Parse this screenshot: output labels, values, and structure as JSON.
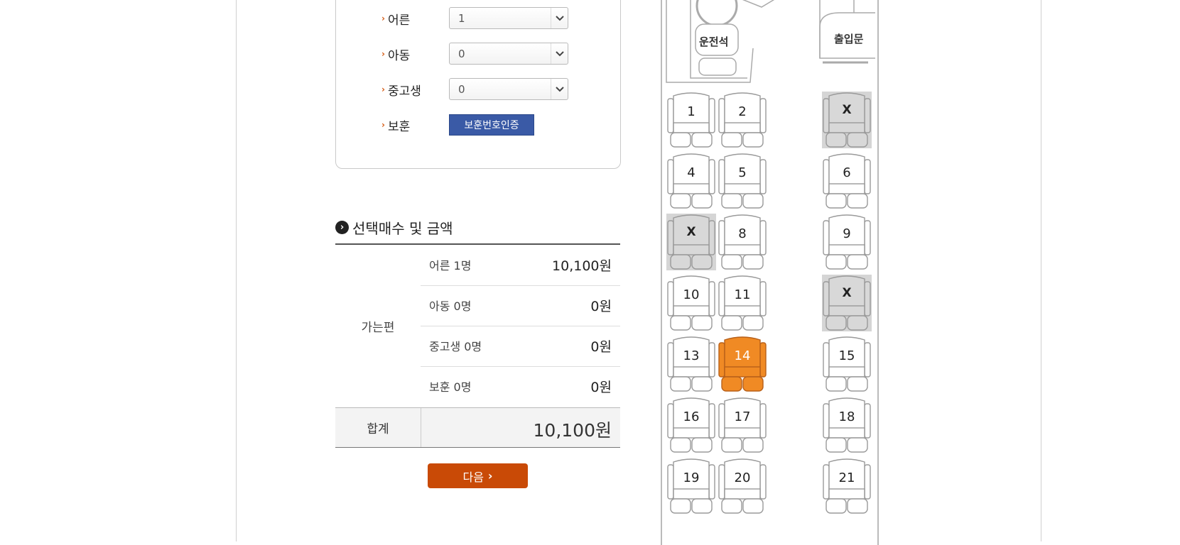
{
  "passenger_types": [
    {
      "label": "어른",
      "selected": "1"
    },
    {
      "label": "아동",
      "selected": "0"
    },
    {
      "label": "중고생",
      "selected": "0"
    }
  ],
  "veteran": {
    "label": "보훈",
    "button": "보훈번호인증"
  },
  "summary": {
    "title": "선택매수 및 금액",
    "direction": "가는편",
    "rows": [
      {
        "label": "어른 1명",
        "amount": "10,100원"
      },
      {
        "label": "아동 0명",
        "amount": "0원"
      },
      {
        "label": "중고생 0명",
        "amount": "0원"
      },
      {
        "label": "보훈 0명",
        "amount": "0원"
      }
    ],
    "total_label": "합계",
    "total_amount": "10,100원"
  },
  "next_button": "다음",
  "bus": {
    "driver_label": "운전석",
    "door_label": "출입문",
    "seats": [
      {
        "label": "1",
        "state": "available"
      },
      {
        "label": "2",
        "state": "available"
      },
      {
        "label": "X",
        "state": "taken"
      },
      {
        "label": "4",
        "state": "available"
      },
      {
        "label": "5",
        "state": "available"
      },
      {
        "label": "6",
        "state": "available"
      },
      {
        "label": "X",
        "state": "taken"
      },
      {
        "label": "8",
        "state": "available"
      },
      {
        "label": "9",
        "state": "available"
      },
      {
        "label": "10",
        "state": "available"
      },
      {
        "label": "11",
        "state": "available"
      },
      {
        "label": "X",
        "state": "taken"
      },
      {
        "label": "13",
        "state": "available"
      },
      {
        "label": "14",
        "state": "selected"
      },
      {
        "label": "15",
        "state": "available"
      },
      {
        "label": "16",
        "state": "available"
      },
      {
        "label": "17",
        "state": "available"
      },
      {
        "label": "18",
        "state": "available"
      },
      {
        "label": "19",
        "state": "available"
      },
      {
        "label": "20",
        "state": "available"
      },
      {
        "label": "21",
        "state": "available"
      }
    ]
  },
  "colors": {
    "accent_orange": "#c94a06",
    "selected_seat": "#f08a24",
    "button_blue": "#3a5aa6",
    "taken_seat": "#d8d8d8"
  }
}
